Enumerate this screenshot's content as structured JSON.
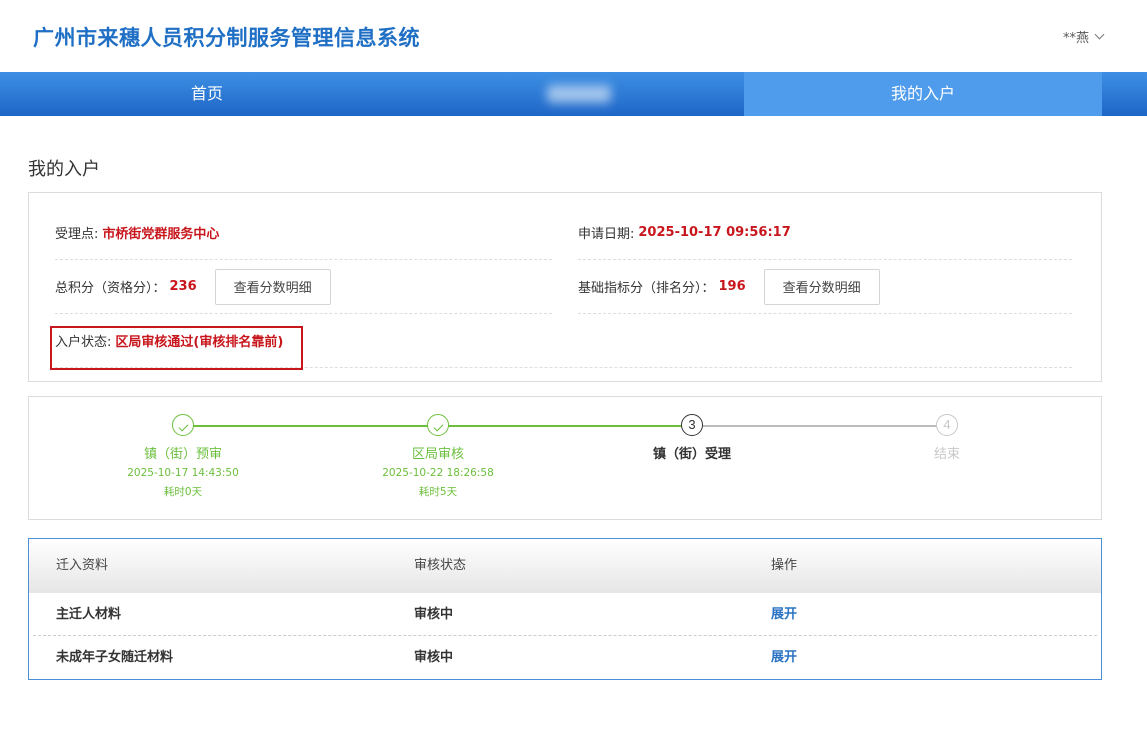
{
  "header": {
    "title": "广州市来穗人员积分制服务管理信息系统",
    "user": "**燕"
  },
  "nav": {
    "items": [
      {
        "label": "首页"
      },
      {
        "label": ""
      },
      {
        "label": "我的入户"
      }
    ],
    "active_index": 2
  },
  "page": {
    "title": "我的入户"
  },
  "info": {
    "acceptance_point_label": "受理点:",
    "acceptance_point_value": "市桥街党群服务中心",
    "apply_date_label": "申请日期:",
    "apply_date_value": "2025-10-17 09:56:17",
    "total_score_label": "总积分（资格分）：",
    "total_score_value": "236",
    "total_score_button": "查看分数明细",
    "base_score_label": "基础指标分（排名分）：",
    "base_score_value": "196",
    "base_score_button": "查看分数明细",
    "status_label": "入户状态:",
    "status_value": "区局审核通过(审核排名靠前)",
    "highlight_color": "#c8161d"
  },
  "progress": {
    "steps": [
      {
        "number": "1",
        "name": "镇（街）预审",
        "date": "2025-10-17 14:43:50",
        "duration": "耗时0天",
        "state": "done"
      },
      {
        "number": "2",
        "name": "区局审核",
        "date": "2025-10-22 18:26:58",
        "duration": "耗时5天",
        "state": "done"
      },
      {
        "number": "3",
        "name": "镇（街）受理",
        "date": "",
        "duration": "",
        "state": "current"
      },
      {
        "number": "4",
        "name": "结束",
        "date": "",
        "duration": "",
        "state": "pending"
      }
    ],
    "done_color": "#6bbf3c",
    "pending_color": "#c8c8c8"
  },
  "table": {
    "headers": [
      "迁入资料",
      "审核状态",
      "操作"
    ],
    "rows": [
      {
        "material": "主迁人材料",
        "status": "审核中",
        "action": "展开"
      },
      {
        "material": "未成年子女随迁材料",
        "status": "审核中",
        "action": "展开"
      }
    ]
  }
}
